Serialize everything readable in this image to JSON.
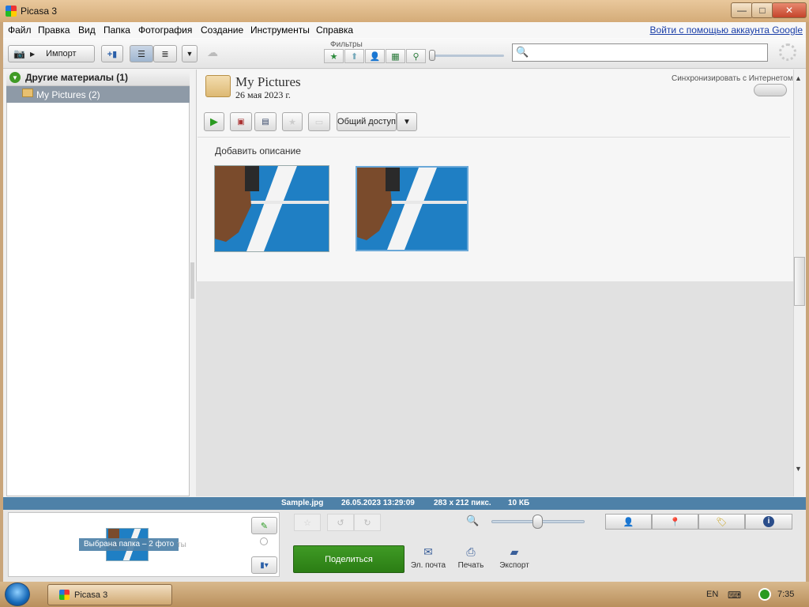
{
  "window": {
    "title": "Picasa 3",
    "min": "—",
    "max": "□",
    "close": "✕"
  },
  "menu": {
    "items": [
      "Файл",
      "Правка",
      "Вид",
      "Папка",
      "Фотография",
      "Создание",
      "Инструменты",
      "Справка"
    ],
    "google_link": "Войти с помощью аккаунта Google"
  },
  "toolbar": {
    "import_label": "Импорт",
    "filters_label": "Фильтры",
    "search_placeholder": ""
  },
  "library": {
    "group_label": "Другие материалы (1)",
    "folder_label": "My Pictures (2)"
  },
  "album": {
    "title": "My Pictures",
    "date": "26 мая 2023 г.",
    "sync_label": "Синхронизировать с Интернетом",
    "share_label": "Общий доступ",
    "add_description": "Добавить описание"
  },
  "status": {
    "filename": "Sample.jpg",
    "datetime": "26.05.2023 13:29:09",
    "dimensions": "283 x 212 пикс.",
    "filesize": "10 КБ"
  },
  "tray": {
    "selection_label": "Выбрана папка – 2 фото",
    "selection_suffix": "ты",
    "share_button": "Поделиться",
    "email": "Эл. почта",
    "print": "Печать",
    "export": "Экспорт"
  },
  "taskbar": {
    "task_label": "Picasa 3",
    "lang": "EN",
    "time": "7:35"
  },
  "colors": {
    "accent_blue": "#4e81a8",
    "share_green": "#2f8a18",
    "track_blue": "#1f7fc4"
  }
}
